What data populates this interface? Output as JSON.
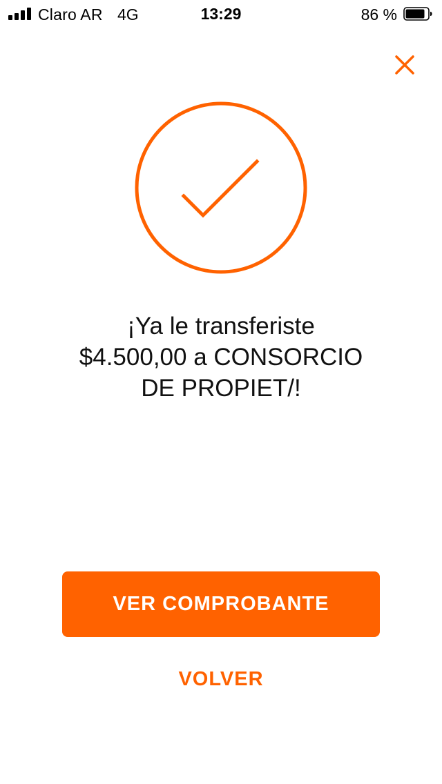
{
  "status_bar": {
    "carrier": "Claro AR",
    "network": "4G",
    "time": "13:29",
    "battery_percent": "86 %",
    "battery_level": 0.86
  },
  "header": {
    "close_icon": "close-icon"
  },
  "success": {
    "icon": "check-circle-icon",
    "message_line1": "¡Ya le transferiste",
    "message_line2": "$4.500,00 a CONSORCIO",
    "message_line3": "DE PROPIET/!"
  },
  "actions": {
    "primary_label": "VER COMPROBANTE",
    "secondary_label": "VOLVER"
  },
  "colors": {
    "accent": "#ff6200",
    "text": "#111111",
    "background": "#ffffff"
  }
}
